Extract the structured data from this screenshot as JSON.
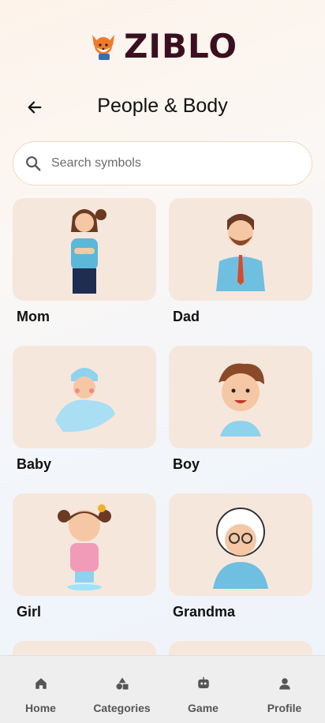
{
  "app": {
    "logo_text": "ZIBLO"
  },
  "header": {
    "title": "People & Body"
  },
  "search": {
    "placeholder": "Search symbols"
  },
  "symbols": [
    {
      "label": "Mom"
    },
    {
      "label": "Dad"
    },
    {
      "label": "Baby"
    },
    {
      "label": "Boy"
    },
    {
      "label": "Girl"
    },
    {
      "label": "Grandma"
    }
  ],
  "tabs": [
    {
      "label": "Home",
      "icon": "home-icon"
    },
    {
      "label": "Categories",
      "icon": "shapes-icon"
    },
    {
      "label": "Game",
      "icon": "robot-icon"
    },
    {
      "label": "Profile",
      "icon": "person-icon"
    }
  ],
  "colors": {
    "tile": "#f6e7dd",
    "logo": "#3a1020",
    "search_border": "#f0d8bf",
    "tabbar": "#eeeeee"
  }
}
